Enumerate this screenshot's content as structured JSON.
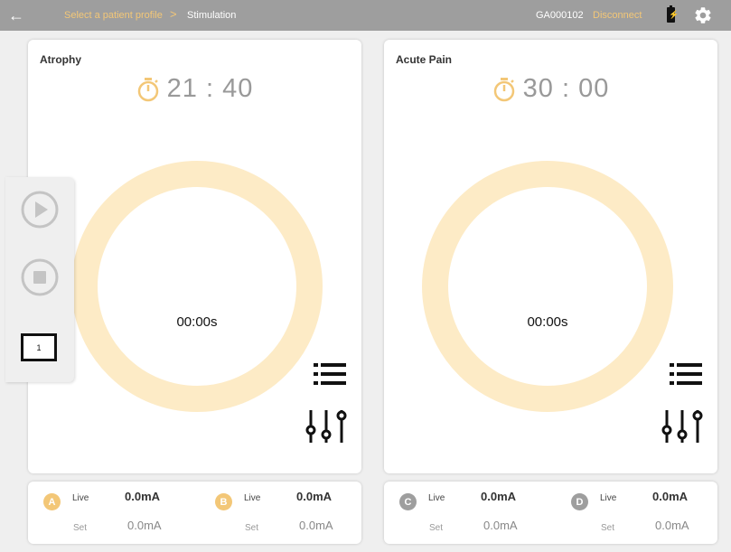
{
  "topbar": {
    "back_icon": "arrow-left-icon",
    "breadcrumb_parent": "Select a patient profile",
    "breadcrumb_separator": ">",
    "breadcrumb_current": "Stimulation",
    "device_id": "GA000102",
    "disconnect_label": "Disconnect",
    "battery_icon": "battery-charging-icon",
    "settings_icon": "gear-icon"
  },
  "programs": [
    {
      "title": "Atrophy",
      "timer": "21 : 40",
      "elapsed": "00:00s"
    },
    {
      "title": "Acute Pain",
      "timer": "30 : 00",
      "elapsed": "00:00s"
    }
  ],
  "sidebar": {
    "box_label": "1"
  },
  "channels": [
    {
      "badge": "A",
      "live_label": "Live",
      "live_value": "0.0mA",
      "set_label": "Set",
      "set_value": "0.0mA"
    },
    {
      "badge": "B",
      "live_label": "Live",
      "live_value": "0.0mA",
      "set_label": "Set",
      "set_value": "0.0mA"
    },
    {
      "badge": "C",
      "live_label": "Live",
      "live_value": "0.0mA",
      "set_label": "Set",
      "set_value": "0.0mA"
    },
    {
      "badge": "D",
      "live_label": "Live",
      "live_value": "0.0mA",
      "set_label": "Set",
      "set_value": "0.0mA"
    }
  ],
  "colors": {
    "accent": "#f3c777",
    "ring": "#fdebc6",
    "topbar": "#9e9e9e",
    "badge_active": "#f3c777",
    "badge_inactive": "#9e9e9e"
  }
}
